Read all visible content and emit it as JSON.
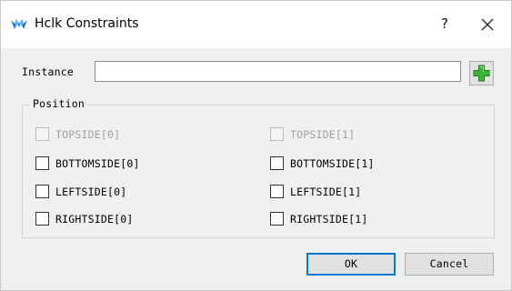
{
  "window": {
    "title": "Hclk Constraints",
    "help_label": "?",
    "icon": "gowin-logo-icon",
    "close_icon": "close-icon"
  },
  "instance": {
    "label": "Instance",
    "value": "",
    "add_icon": "plus-icon"
  },
  "position": {
    "title": "Position",
    "left_column": [
      {
        "label": "TOPSIDE[0]",
        "checked": false,
        "enabled": false
      },
      {
        "label": "BOTTOMSIDE[0]",
        "checked": false,
        "enabled": true
      },
      {
        "label": "LEFTSIDE[0]",
        "checked": false,
        "enabled": true
      },
      {
        "label": "RIGHTSIDE[0]",
        "checked": false,
        "enabled": true
      }
    ],
    "right_column": [
      {
        "label": "TOPSIDE[1]",
        "checked": false,
        "enabled": false
      },
      {
        "label": "BOTTOMSIDE[1]",
        "checked": false,
        "enabled": true
      },
      {
        "label": "LEFTSIDE[1]",
        "checked": false,
        "enabled": true
      },
      {
        "label": "RIGHTSIDE[1]",
        "checked": false,
        "enabled": true
      }
    ]
  },
  "buttons": {
    "ok": "OK",
    "cancel": "Cancel"
  },
  "colors": {
    "accent": "#0078d7",
    "logo_blue": "#1e6fd9",
    "plus_green": "#3cb43c"
  }
}
